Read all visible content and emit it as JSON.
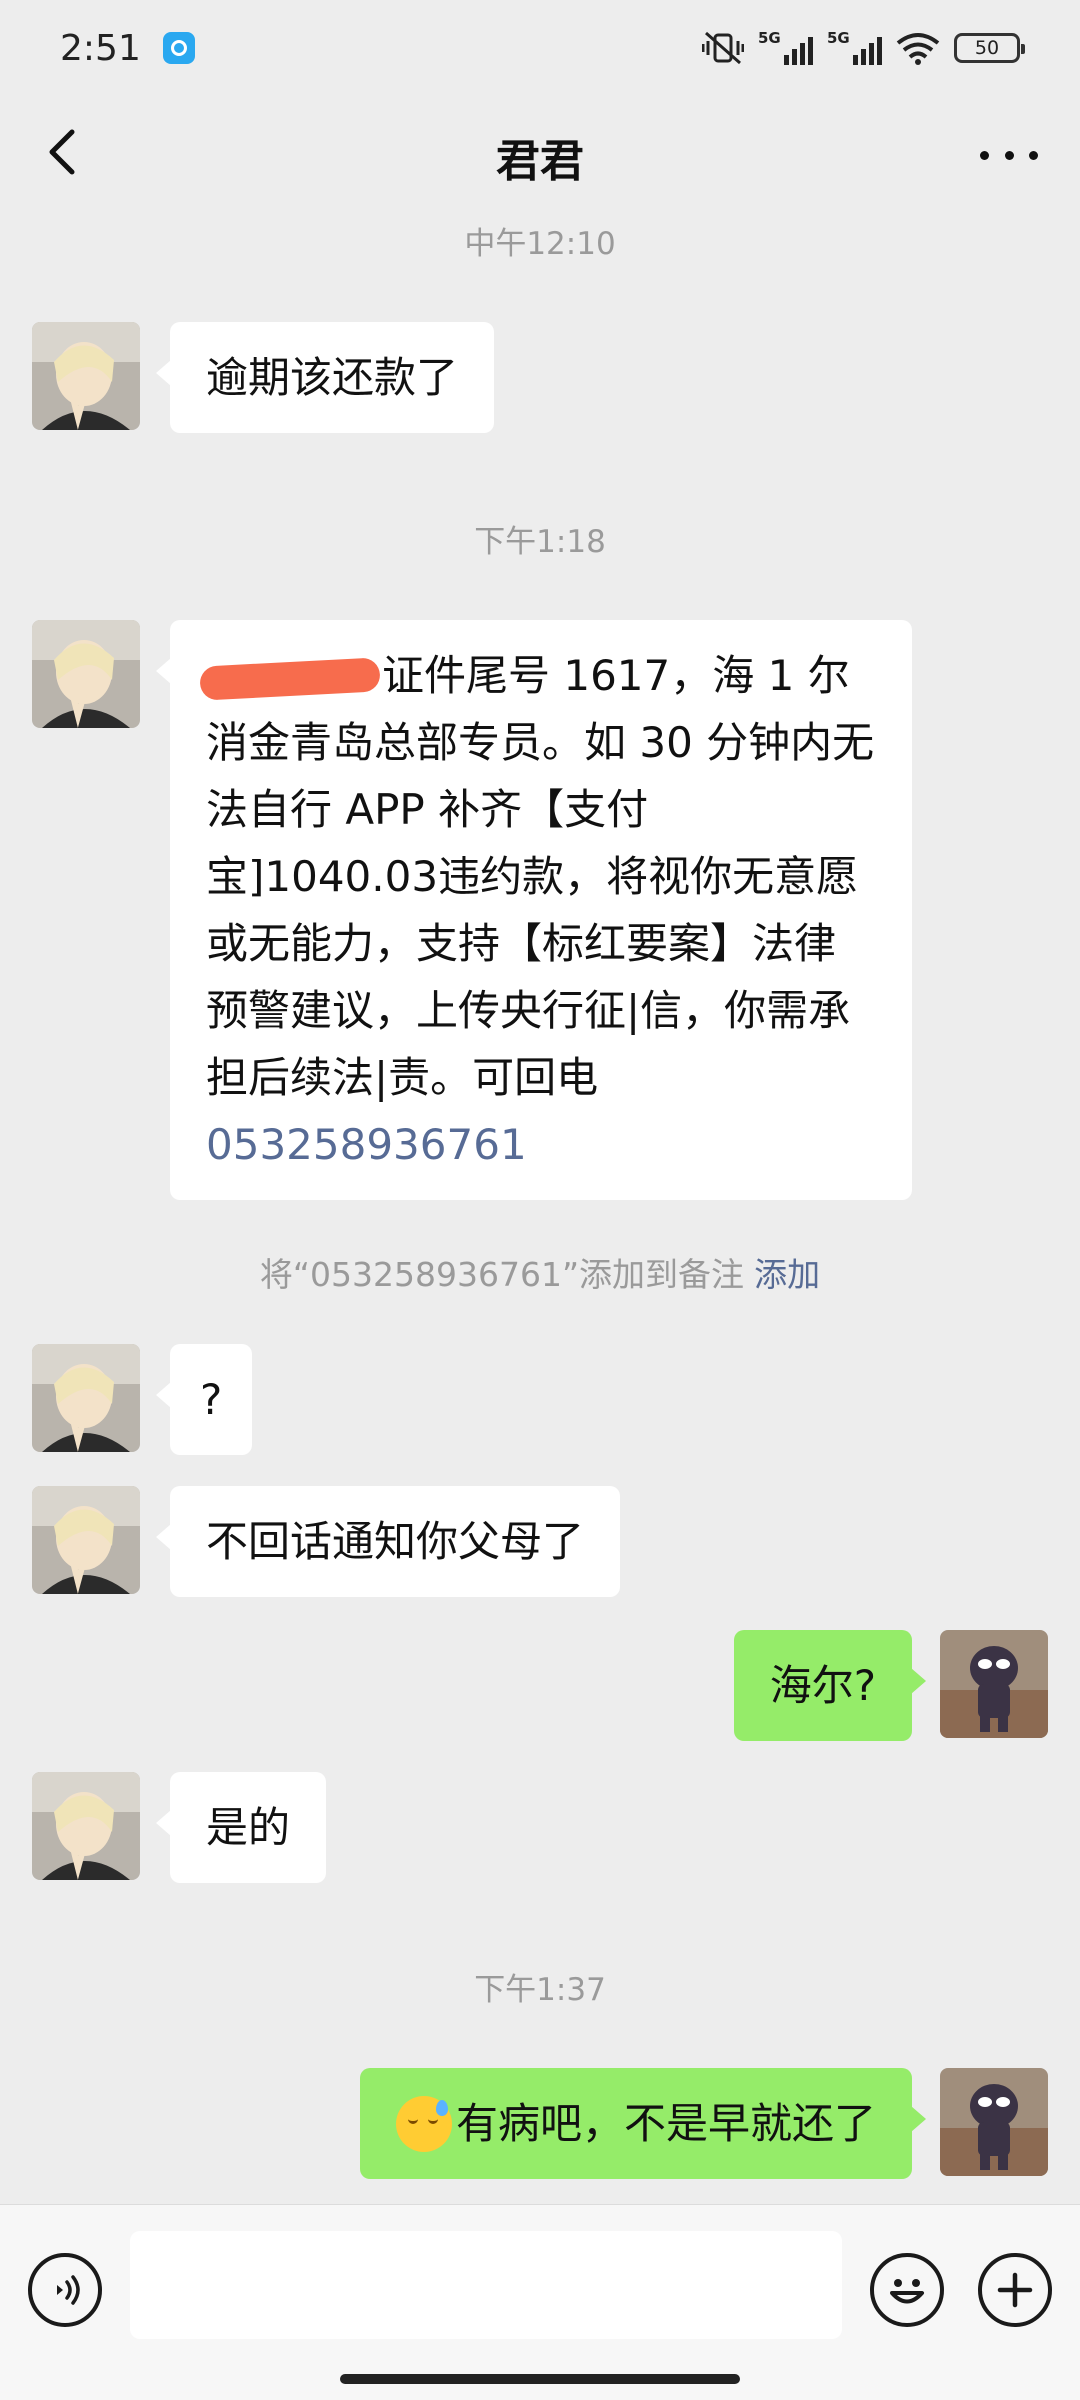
{
  "status_bar": {
    "time": "2:51",
    "battery": "50",
    "network_label": "5G",
    "icons": [
      "app-notification-icon",
      "mute-vibrate-icon",
      "signal-5g-icon",
      "signal-5g-icon",
      "wifi-icon",
      "battery-icon"
    ]
  },
  "header": {
    "title": "君君",
    "back_icon": "chevron-left-icon",
    "more_icon": "more-dots-icon"
  },
  "messages": {
    "t1": "中午12:10",
    "m1": "逾期该还款了",
    "t2": "下午1:18",
    "m2_text": "证件尾号 1617，海 1 尔消金青岛总部专员。如 30 分钟内无法自行 APP 补齐【支付宝]1040.03违约款，将视你无意愿或无能力，支持【标红要案】法律预警建议，上传央行征|信，你需承担后续法|责。可回电",
    "m2_phone": "053258936761",
    "note_text": "将“053258936761”添加到备注",
    "note_link": "添加",
    "m3": "?",
    "m4": "不回话通知你父母了",
    "m5": "海尔?",
    "m6": "是的",
    "t3": "下午1:37",
    "m7": "有病吧，不是早就还了"
  },
  "input_bar": {
    "placeholder": "",
    "icons": [
      "voice-icon",
      "emoji-icon",
      "plus-icon"
    ]
  },
  "colors": {
    "background": "#ededed",
    "incoming_bubble": "#ffffff",
    "outgoing_bubble": "#95ec69",
    "link": "#576b95",
    "redaction": "#f76c4d"
  }
}
